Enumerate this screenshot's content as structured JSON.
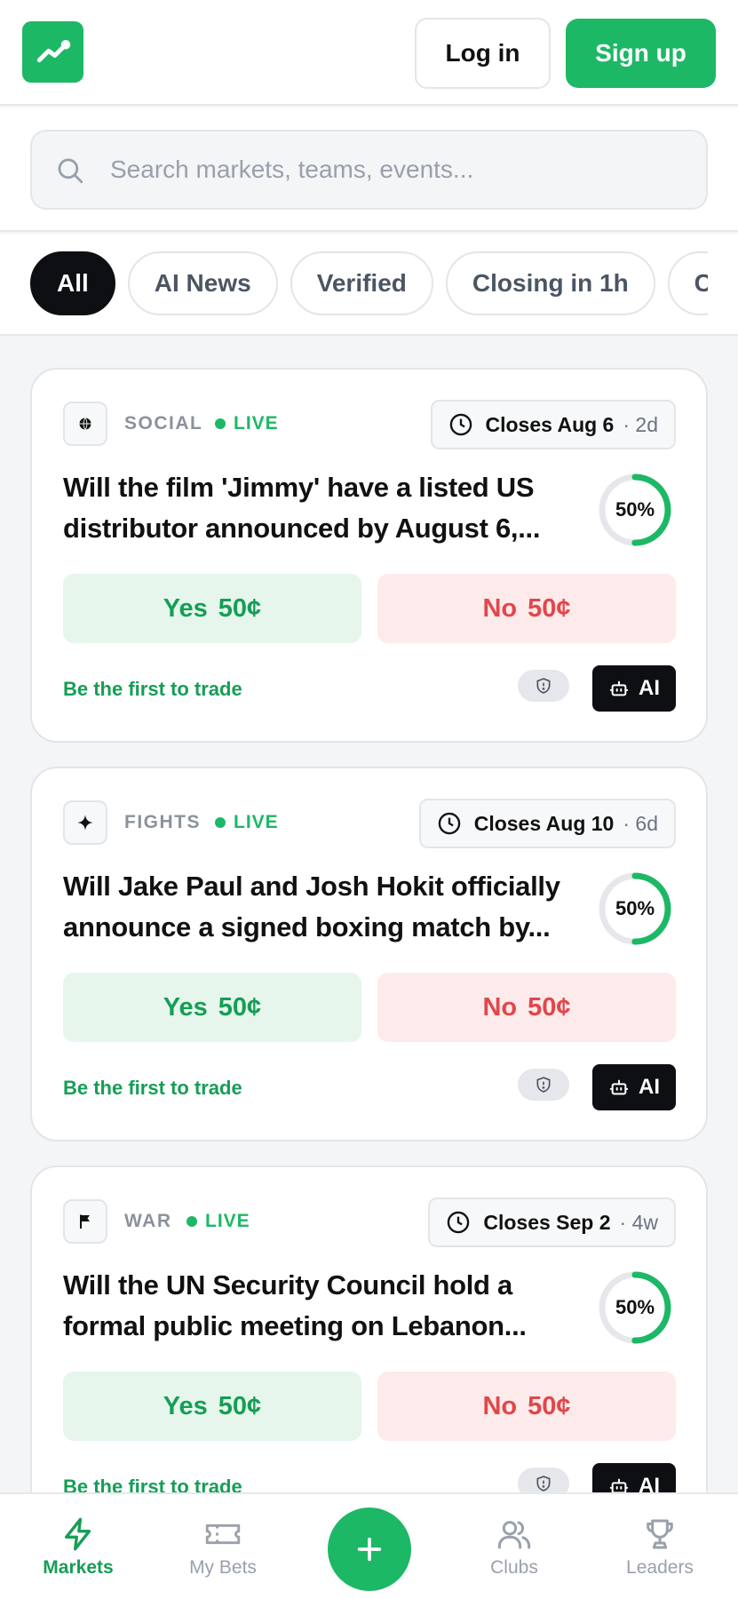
{
  "header": {
    "logo_icon": "trending-up-icon",
    "login_label": "Log in",
    "signup_label": "Sign up",
    "brand_color": "#1db866"
  },
  "search": {
    "placeholder": "Search markets, teams, events..."
  },
  "filters": [
    {
      "label": "All",
      "active": true
    },
    {
      "label": "AI News",
      "active": false
    },
    {
      "label": "Verified",
      "active": false
    },
    {
      "label": "Closing in 1h",
      "active": false
    },
    {
      "label": "Clo",
      "active": false
    }
  ],
  "markets": [
    {
      "category": "SOCIAL",
      "category_icon": "globe-icon",
      "status": "LIVE",
      "closes": "Closes Aug 6",
      "relative": "· 2d",
      "question_line1": "Will the film 'Jimmy' have a listed US",
      "question_line2": "distributor announced by August 6,...",
      "probability": "50%",
      "probability_value": 0.5,
      "yes_label": "Yes",
      "yes_price": "50¢",
      "no_label": "No",
      "no_price": "50¢",
      "footer": "Be the first to trade",
      "ai_label": "AI"
    },
    {
      "category": "FIGHTS",
      "category_icon": "sparkle-icon",
      "status": "LIVE",
      "closes": "Closes Aug 10",
      "relative": "· 6d",
      "question_line1": "Will Jake Paul and Josh Hokit officially",
      "question_line2": "announce a signed boxing match by...",
      "probability": "50%",
      "probability_value": 0.5,
      "yes_label": "Yes",
      "yes_price": "50¢",
      "no_label": "No",
      "no_price": "50¢",
      "footer": "Be the first to trade",
      "ai_label": "AI"
    },
    {
      "category": "WAR",
      "category_icon": "flag-icon",
      "status": "LIVE",
      "closes": "Closes Sep 2",
      "relative": "· 4w",
      "question_line1": "Will the UN Security Council hold a",
      "question_line2": "formal public meeting on Lebanon...",
      "probability": "50%",
      "probability_value": 0.5,
      "yes_label": "Yes",
      "yes_price": "50¢",
      "no_label": "No",
      "no_price": "50¢",
      "footer": "Be the first to trade",
      "ai_label": "AI"
    }
  ],
  "nav": {
    "markets": "Markets",
    "my_bets": "My Bets",
    "clubs": "Clubs",
    "leaders": "Leaders",
    "fab_icon": "plus-icon"
  }
}
